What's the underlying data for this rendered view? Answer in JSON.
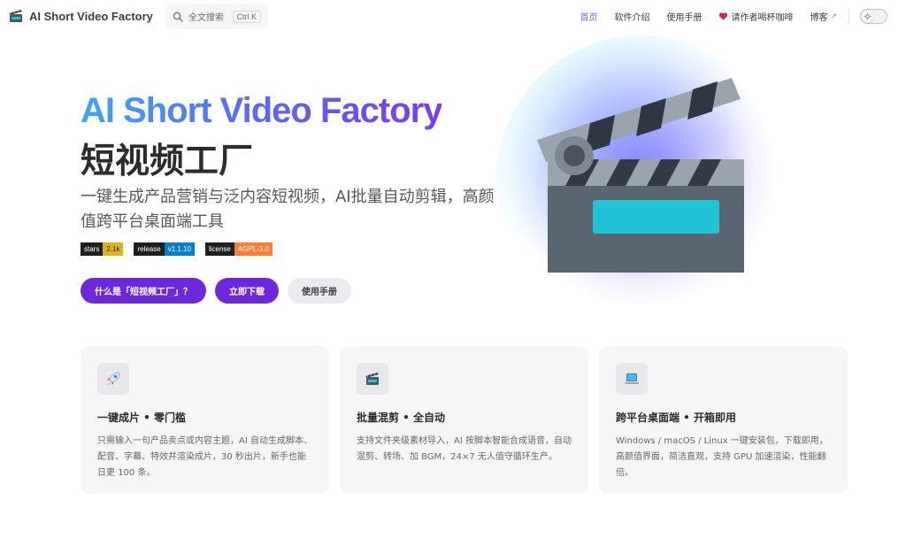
{
  "nav": {
    "brand": "AI Short Video Factory",
    "search_placeholder": "全文搜索",
    "search_shortcut": "Ctrl K",
    "links": [
      {
        "label": "首页",
        "active": true
      },
      {
        "label": "软件介绍"
      },
      {
        "label": "使用手册"
      },
      {
        "label": "请作者喝杯咖啡",
        "icon": "heart-icon"
      },
      {
        "label": "博客",
        "icon": "external-link-icon"
      }
    ],
    "ext_glyph": "↗"
  },
  "hero": {
    "title": "AI Short Video Factory",
    "subtitle": "短视频工厂",
    "tagline": "一键生成产品营销与泛内容短视频，AI批量自动剪辑，高颜值跨平台桌面端工具",
    "badges": [
      {
        "key": "stars",
        "value": "2.1k",
        "color": "#dfb317"
      },
      {
        "key": "release",
        "value": "v1.1.10",
        "color": "#007ec6"
      },
      {
        "key": "license",
        "value": "AGPL-3.0",
        "color": "#fe7d37"
      }
    ],
    "buttons": [
      {
        "label": "什么是「短视频工厂」？"
      },
      {
        "label": "立即下载"
      },
      {
        "label": "使用手册"
      }
    ],
    "image_icon": "clapperboard-icon"
  },
  "features": [
    {
      "icon": "rocket-icon",
      "title": "一键成片 • 零门槛",
      "desc": "只需输入一句产品卖点或内容主题，AI 自动生成脚本、配音、字幕、特效并渲染成片，30 秒出片，新手也能日更 100 条。"
    },
    {
      "icon": "clapperboard-icon",
      "title": "批量混剪 • 全自动",
      "desc": "支持文件夹级素材导入，AI 按脚本智能合成语音，自动混剪、转场、加 BGM，24×7 无人值守循环生产。"
    },
    {
      "icon": "laptop-icon",
      "title": "跨平台桌面端 • 开箱即用",
      "desc": "Windows / macOS / Linux 一键安装包，下载即用，高颜值界面，简洁直观，支持 GPU 加速渲染，性能翻倍。"
    }
  ],
  "colors": {
    "accent": "#646cff",
    "primary_button": "#6d28d9"
  }
}
